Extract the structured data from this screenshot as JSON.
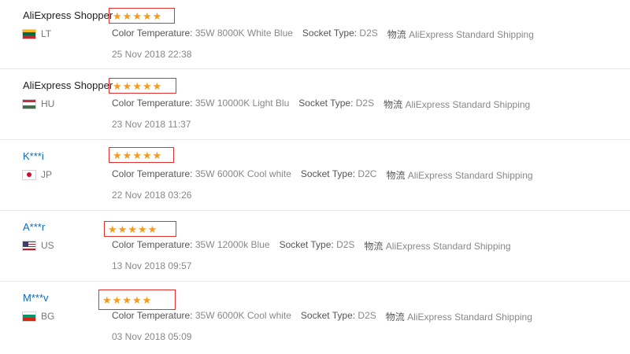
{
  "reviews": [
    {
      "user": "AliExpress Shopper",
      "country": "LT",
      "flag": {
        "type": "bands",
        "colors": [
          "#fdb913",
          "#006a44",
          "#c1272d"
        ]
      },
      "rating": 5,
      "color_label": "Color Temperature:",
      "color_value": "35W 8000K White Blue",
      "socket_label": "Socket Type:",
      "socket_value": "D2S",
      "ship_label": "物流",
      "ship_value": "AliExpress Standard Shipping",
      "date": "25 Nov 2018 22:38"
    },
    {
      "user": "AliExpress Shopper",
      "country": "HU",
      "flag": {
        "type": "bands",
        "colors": [
          "#cd2a3e",
          "#ffffff",
          "#436f4d"
        ]
      },
      "rating": 5,
      "color_label": "Color Temperature:",
      "color_value": "35W 10000K Light Blu",
      "socket_label": "Socket Type:",
      "socket_value": "D2S",
      "ship_label": "物流",
      "ship_value": "AliExpress Standard Shipping",
      "date": "23 Nov 2018 11:37"
    },
    {
      "user": "K***i",
      "country": "JP",
      "flag": {
        "type": "jp",
        "colors": [
          "#ffffff",
          "#c8102e"
        ]
      },
      "rating": 5,
      "color_label": "Color Temperature:",
      "color_value": "35W 6000K Cool white",
      "socket_label": "Socket Type:",
      "socket_value": "D2C",
      "ship_label": "物流",
      "ship_value": "AliExpress Standard Shipping",
      "date": "22 Nov 2018 03:26"
    },
    {
      "user": "A***r",
      "country": "US",
      "flag": {
        "type": "us",
        "colors": [
          "#b22234",
          "#ffffff",
          "#3c3b6e"
        ]
      },
      "rating": 5,
      "color_label": "Color Temperature:",
      "color_value": "35W 12000k Blue",
      "socket_label": "Socket Type:",
      "socket_value": "D2S",
      "ship_label": "物流",
      "ship_value": "AliExpress Standard Shipping",
      "date": "13 Nov 2018 09:57"
    },
    {
      "user": "M***v",
      "country": "BG",
      "flag": {
        "type": "bands",
        "colors": [
          "#ffffff",
          "#00966e",
          "#d62612"
        ]
      },
      "rating": 5,
      "color_label": "Color Temperature:",
      "color_value": "35W 6000K Cool white",
      "socket_label": "Socket Type:",
      "socket_value": "D2S",
      "ship_label": "物流",
      "ship_value": "AliExpress Standard Shipping",
      "date": "03 Nov 2018 05:09"
    }
  ],
  "colors": {
    "star": "#f59a1b",
    "highlight_box": "#e0322b",
    "masked_name": "#0b6bb5"
  }
}
